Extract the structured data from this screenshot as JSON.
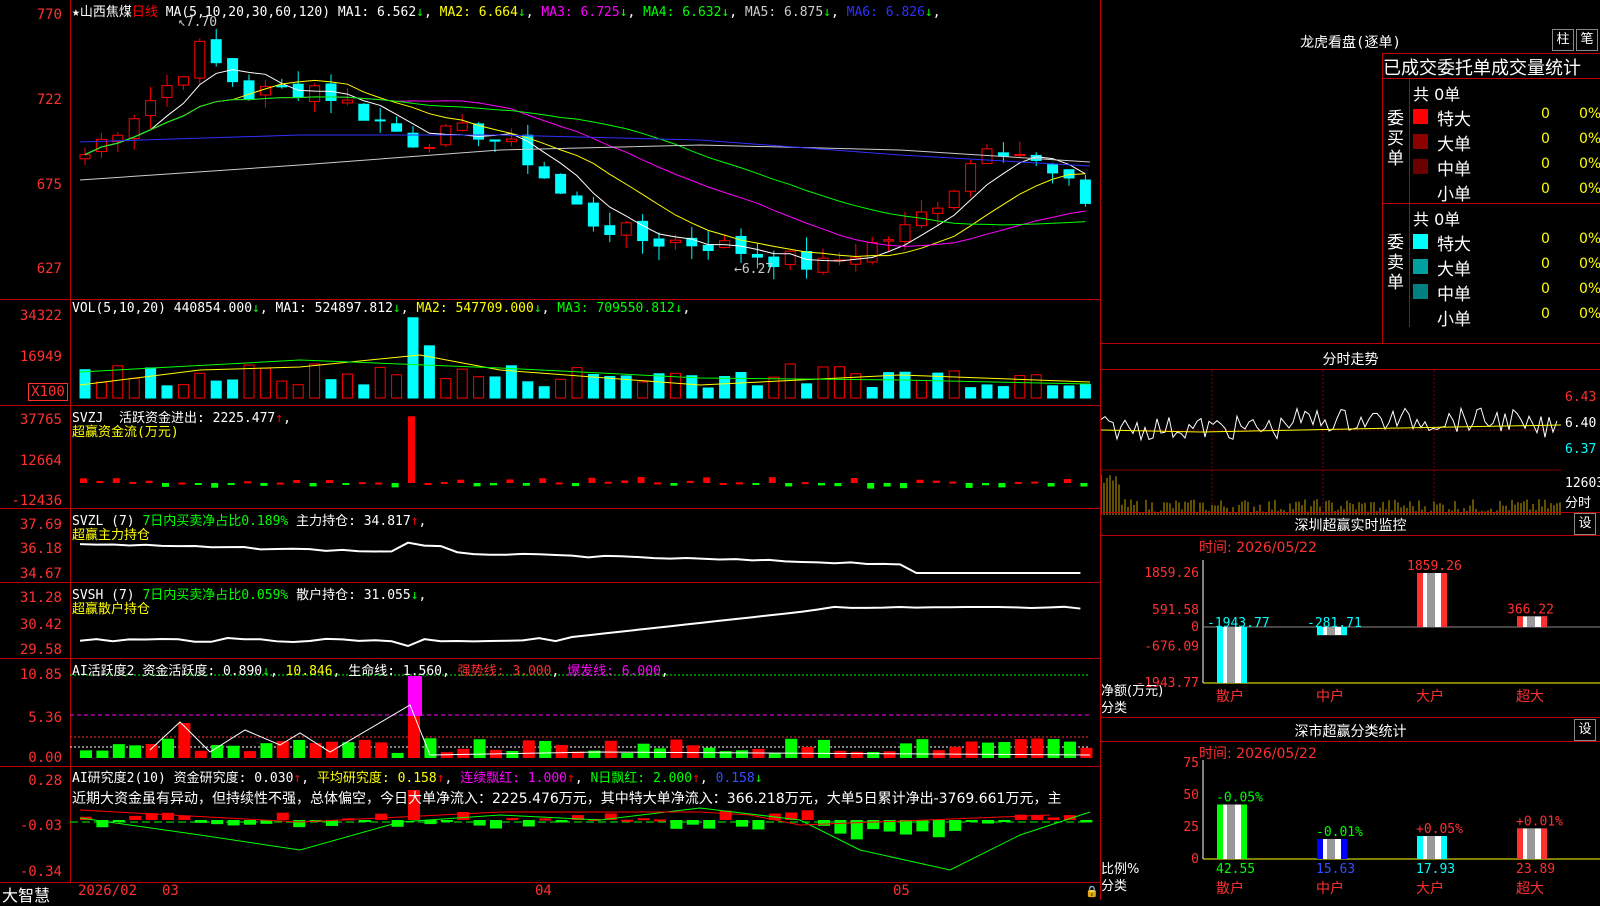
{
  "stock": {
    "star": "★",
    "name": "山西焦煤",
    "period": "日线",
    "ma_params": "MA(5,10,20,30,60,120)",
    "ma": [
      {
        "label": "MA1:",
        "value": "6.562",
        "arrow": "↓",
        "color": "#ffffff"
      },
      {
        "label": "MA2:",
        "value": "6.664",
        "arrow": "↓",
        "color": "#ffff00"
      },
      {
        "label": "MA3:",
        "value": "6.725",
        "arrow": "↓",
        "color": "#ff00ff"
      },
      {
        "label": "MA4:",
        "value": "6.632",
        "arrow": "↓",
        "color": "#00ff00"
      },
      {
        "label": "MA5:",
        "value": "6.875",
        "arrow": "↓",
        "color": "#cccccc"
      },
      {
        "label": "MA6:",
        "value": "6.826",
        "arrow": "↓",
        "color": "#3030ff"
      }
    ],
    "high_mark": "7.70",
    "low_mark": "6.27"
  },
  "price_axis": [
    "770",
    "722",
    "675",
    "627"
  ],
  "vol": {
    "params": "VOL(5,10,20)",
    "value": "440854.000",
    "arrow": "↓",
    "ma": [
      {
        "label": "MA1:",
        "value": "524897.812",
        "arrow": "↓",
        "color": "#ffffff"
      },
      {
        "label": "MA2:",
        "value": "547709.000",
        "arrow": "↓",
        "color": "#ffff00"
      },
      {
        "label": "MA3:",
        "value": "709550.812",
        "arrow": "↓",
        "color": "#00ff00"
      }
    ],
    "axis": [
      "34322",
      "16949",
      "X100"
    ]
  },
  "svzj": {
    "name": "SVZJ",
    "label": "活跃资金进出:",
    "value": "2225.477",
    "arrow": "↑",
    "sub": "超赢资金流(万元)",
    "axis": [
      "37765",
      "12664",
      "-12436"
    ]
  },
  "svzl": {
    "name": "SVZL",
    "param": "(7)",
    "desc": "7日内买卖净占比0.189%",
    "label": "主力持仓:",
    "value": "34.817",
    "arrow": "↑",
    "sub": "超赢主力持仓",
    "axis": [
      "37.69",
      "36.18",
      "34.67"
    ]
  },
  "svsh": {
    "name": "SVSH",
    "param": "(7)",
    "desc": "7日内买卖净占比0.059%",
    "label": "散户持仓:",
    "value": "31.055",
    "arrow": "↓",
    "sub": "超赢散户持仓",
    "axis": [
      "31.28",
      "30.42",
      "29.58"
    ]
  },
  "ai_active": {
    "name": "AI活跃度2",
    "label1": "资金活跃度:",
    "v1": "0.890",
    "a1": "↓",
    "v2": "10.846",
    "label3": "生命线:",
    "v3": "1.560",
    "label4": "强势线:",
    "v4": "3.000",
    "label5": "爆发线:",
    "v5": "6.000",
    "axis": [
      "10.85",
      "5.36",
      "0.00"
    ]
  },
  "ai_research": {
    "name": "AI研究度2(10)",
    "label1": "资金研究度:",
    "v1": "0.030",
    "a1": "↑",
    "label2": "平均研究度:",
    "v2": "0.158",
    "a2": "↑",
    "label3": "连续飘红:",
    "v3": "1.000",
    "a3": "↑",
    "label4": "N日飘红:",
    "v4": "2.000",
    "a4": "↑",
    "v5": "0.158",
    "a5": "↓",
    "comment": "近期大资金虽有异动，但持续性不强，总体偏空，今日大单净流入：2225.476万元，其中特大单净流入：366.218万元，大单5日累计净出-3769.661万元，主",
    "axis": [
      "0.28",
      "-0.03",
      "-0.34"
    ]
  },
  "x_axis": {
    "brand": "大智慧",
    "labels": [
      "2026/02",
      "03",
      "04",
      "05"
    ]
  },
  "longhu": {
    "title": "龙虎看盘(逐单)",
    "btn1": "柱",
    "btn2": "笔",
    "tabs": [
      "已成交",
      "委托单",
      "成交量统计"
    ],
    "buy_side": "委买单",
    "sell_side": "委卖单",
    "buy_total": "共 0单",
    "sell_total": "共 0单",
    "buy_rows": [
      {
        "label": "特大",
        "n": "0",
        "pct": "0%",
        "color": "#ff0000"
      },
      {
        "label": "大单",
        "n": "0",
        "pct": "0%",
        "color": "#8b0000"
      },
      {
        "label": "中单",
        "n": "0",
        "pct": "0%",
        "color": "#6b0000"
      },
      {
        "label": "小单",
        "n": "0",
        "pct": "0%",
        "color": "#000000"
      }
    ],
    "sell_rows": [
      {
        "label": "特大",
        "n": "0",
        "pct": "0%",
        "color": "#00ffff"
      },
      {
        "label": "大单",
        "n": "0",
        "pct": "0%",
        "color": "#00a0a0"
      },
      {
        "label": "中单",
        "n": "0",
        "pct": "0%",
        "color": "#008080"
      },
      {
        "label": "小单",
        "n": "0",
        "pct": "0%",
        "color": "#000000"
      }
    ]
  },
  "intraday": {
    "title": "分时走势",
    "axis": [
      "6.43",
      "6.40",
      "6.37"
    ],
    "vol_label": "12603",
    "vol_unit": "分时"
  },
  "monitor": {
    "title": "深圳超赢实时监控",
    "btn": "设",
    "time": "时间: 2026/05/22",
    "axis": [
      "1859.26",
      "591.58",
      "0",
      "-676.09",
      "-1943.77"
    ],
    "ylabel": "净额(万元)",
    "xlabel": "分类",
    "categories": [
      "散户",
      "中户",
      "大户",
      "超大"
    ],
    "values": [
      -1943.77,
      -281.71,
      1859.26,
      366.22
    ],
    "value_labels": [
      "-1943.77",
      "-281.71",
      "1859.26",
      "366.22"
    ]
  },
  "classify": {
    "title": "深市超赢分类统计",
    "btn": "设",
    "time": "时间: 2026/05/22",
    "axis": [
      "75",
      "50",
      "25",
      "0"
    ],
    "ylabel": "比例%",
    "xlabel": "分类",
    "categories": [
      "散户",
      "中户",
      "大户",
      "超大"
    ],
    "values": [
      42.55,
      15.63,
      17.93,
      23.89
    ],
    "change": [
      "-0.05%",
      "-0.01%",
      "+0.05%",
      "+0.01%"
    ],
    "value_labels": [
      "42.55",
      "15.63",
      "17.93",
      "23.89"
    ]
  },
  "colors": {
    "up": "#ff0000",
    "down": "#00ffff",
    "axis": "#ff3030",
    "border": "#c00000"
  }
}
